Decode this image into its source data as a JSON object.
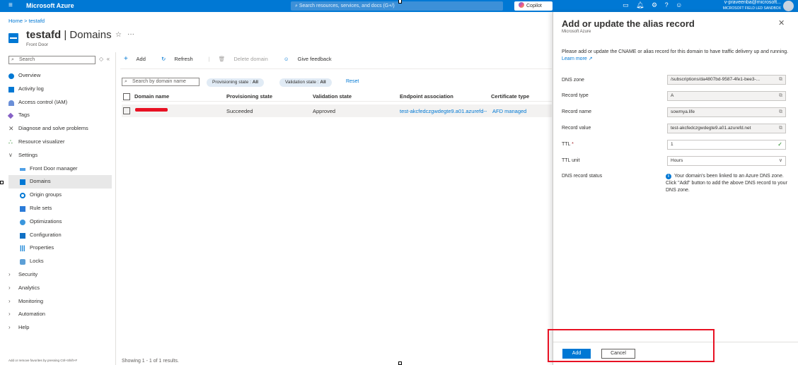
{
  "topbar": {
    "menu_icon": "hamburger-icon",
    "brand": "Microsoft Azure",
    "search_placeholder": "Search resources, services, and docs (G+/)",
    "copilot": "Copilot",
    "user_name": "v-praveenba@microsoft...",
    "tenant": "MICROSOFT FIELD LED SANDBOX"
  },
  "breadcrumb": "Home > testafd",
  "header": {
    "resource": "testafd",
    "section": "Domains",
    "subtitle": "Front Door"
  },
  "sidebar": {
    "search_placeholder": "Search",
    "items": [
      {
        "label": "Overview",
        "icon": "globe-icon"
      },
      {
        "label": "Activity log",
        "icon": "log-icon"
      },
      {
        "label": "Access control (IAM)",
        "icon": "iam-icon"
      },
      {
        "label": "Tags",
        "icon": "tag-icon"
      },
      {
        "label": "Diagnose and solve problems",
        "icon": "diagnose-icon"
      },
      {
        "label": "Resource visualizer",
        "icon": "visualizer-icon"
      },
      {
        "label": "Settings",
        "icon": "chevron-down-icon"
      },
      {
        "label": "Front Door manager",
        "icon": "frontdoor-icon"
      },
      {
        "label": "Domains",
        "icon": "domains-icon"
      },
      {
        "label": "Origin groups",
        "icon": "origin-icon"
      },
      {
        "label": "Rule sets",
        "icon": "rules-icon"
      },
      {
        "label": "Optimizations",
        "icon": "optimizations-icon"
      },
      {
        "label": "Configuration",
        "icon": "configuration-icon"
      },
      {
        "label": "Properties",
        "icon": "properties-icon"
      },
      {
        "label": "Locks",
        "icon": "lock-icon"
      },
      {
        "label": "Security",
        "icon": "chevron-right-icon"
      },
      {
        "label": "Analytics",
        "icon": "chevron-right-icon"
      },
      {
        "label": "Monitoring",
        "icon": "chevron-right-icon"
      },
      {
        "label": "Automation",
        "icon": "chevron-right-icon"
      },
      {
        "label": "Help",
        "icon": "chevron-right-icon"
      }
    ],
    "footer": "Add or remove favorites by pressing Ctrl+Shift+F"
  },
  "toolbar": {
    "add": "Add",
    "refresh": "Refresh",
    "delete": "Delete domain",
    "feedback": "Give feedback"
  },
  "filters": {
    "search_placeholder": "Search by domain name",
    "provisioning": "Provisioning state : ",
    "provisioning_value": "All",
    "validation": "Validation state : ",
    "validation_value": "All",
    "reset": "Reset"
  },
  "table": {
    "headers": [
      "Domain name",
      "Provisioning state",
      "Validation state",
      "Endpoint association",
      "Certificate type"
    ],
    "rows": [
      {
        "provisioning": "Succeeded",
        "validation": "Approved",
        "endpoint": "test-akcfedczgwdegte9.a01.azurefd--",
        "certificate": "AFD managed"
      }
    ]
  },
  "showing": "Showing 1 - 1 of 1 results.",
  "panel": {
    "title": "Add or update the alias record",
    "subtitle": "Microsoft Azure",
    "description": "Please add or update the CNAME or alias record for this domain to have traffic delivery up and running.",
    "learn_more": "Learn more",
    "fields": {
      "dns_zone_label": "DNS zone",
      "dns_zone_value": "/subscriptions/da4807bd-9587-4fe1-bee3-...",
      "record_type_label": "Record type",
      "record_type_value": "A",
      "record_name_label": "Record name",
      "record_name_value": "sowmya.life",
      "record_value_label": "Record value",
      "record_value_value": "test-akcfedczgwdegte9.a01.azurefd.net",
      "ttl_label": "TTL",
      "ttl_value": "1",
      "ttl_unit_label": "TTL unit",
      "ttl_unit_value": "Hours",
      "status_label": "DNS record status",
      "status_value": "Your domain's been linked to an Azure DNS zone. Click \"Add\" button to add the above DNS record to your DNS zone."
    },
    "add_button": "Add",
    "cancel_button": "Cancel"
  },
  "colors": {
    "azure_blue": "#0078d4",
    "highlight_red": "#e81123"
  }
}
